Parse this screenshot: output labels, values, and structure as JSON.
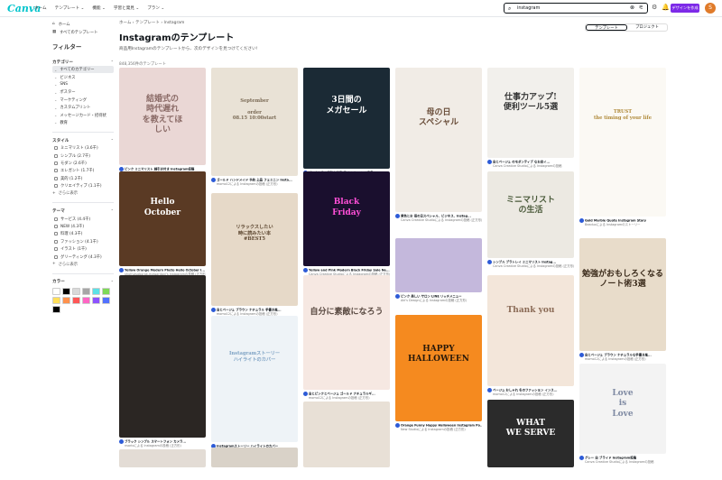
{
  "topbar": {
    "logo": "Canva",
    "nav": [
      "ホーム",
      "テンプレート ⌄",
      "機能 ⌄",
      "学習と発見 ⌄",
      "プラン ⌄"
    ],
    "search_value": "instagram",
    "create_button": "デザインを作成",
    "avatar_initial": "S"
  },
  "sidebar": {
    "home": "ホーム",
    "all_templates": "すべてのテンプレート",
    "filter_title": "フィルター",
    "sections": [
      {
        "title": "カテゴリー",
        "items": [
          "すべてのカテゴリー",
          "ビジネス",
          "SNS",
          "ポスター",
          "マーケティング",
          "カスタムプリント",
          "メッセージカード・招待状",
          "教育"
        ],
        "selected": 0,
        "type": "chevron"
      },
      {
        "title": "スタイル",
        "items": [
          "ミニマリスト (3.6千)",
          "シンプル (2.7千)",
          "モダン (2.6千)",
          "エレガント (1.7千)",
          "美的 (1.2千)",
          "クリエイティブ (1.1千)"
        ],
        "more": "さらに表示",
        "type": "check"
      },
      {
        "title": "テーマ",
        "items": [
          "サービス (4.4千)",
          "NEW (4.3千)",
          "料理 (4.3千)",
          "ファッション (4.1千)",
          "イラスト (1千)",
          "グリーティング (4.3千)"
        ],
        "more": "さらに表示",
        "type": "check"
      }
    ],
    "color_title": "カラー",
    "colors": [
      "#ffffff",
      "#000000",
      "#d9d9d9",
      "#a6a6a6",
      "#5ce1e6",
      "#7ed957",
      "#ffde59",
      "#ff914d",
      "#ff5757",
      "#ff66c4",
      "#8c52ff",
      "#5271ff",
      "#000000"
    ]
  },
  "main": {
    "breadcrumb": "ホーム  ›  テンプレート  ›  Instagram",
    "title": "Instagramのテンプレート",
    "subtitle": "商品用Instagramのテンプレートから、次のデザインを見つけてください!",
    "count": "848,356件のテンプレート",
    "tabs": [
      "テンプレート",
      "プロジェクト"
    ]
  },
  "cards": [
    {
      "title": "ピンク ミニマリスト 線引き付き Instagram投稿",
      "author": "Canva Creative Studioによる Instagramの投稿 (正方形)",
      "bg": "#ead7d5",
      "text": "結婚式の\n時代遅れ\nを教えてほ\nしい",
      "fg": "#8a6a66"
    },
    {
      "title": "Yellow Orange Modern Photo Hello October I...",
      "author": "shuhyasoborak-mawardani's Instagramの投稿 (正方形)",
      "bg": "#5a3a24",
      "text": "Hello\nOctober",
      "fg": "#ffffff"
    },
    {
      "title": "ブラック シンプル スマートフォン カメラ...",
      "author": "nsarioによる Instagramの投稿 (正方形)",
      "bg": "#2b2623",
      "text": "",
      "fg": "#fff"
    },
    {
      "title": "",
      "author": "",
      "bg": "#e3dcd5",
      "text": "",
      "fg": "#fff"
    },
    {
      "title": "ゴールド ハンドメイド 予約 上品 フェミニン Insta...",
      "author": "momo12による Instagramの投稿 (正方形)",
      "bg": "#e9e2d6",
      "text": "September\n\norder\n08.15 10:00start",
      "fg": "#7a6a55"
    },
    {
      "title": "白とベージュ ブラウン ナチュラル 手書き風...",
      "author": "momo12による Instagramの投稿 (正方形)",
      "bg": "#e6d9c8",
      "text": "リラックスしたい\n時に読みたい本\n#BEST5",
      "fg": "#5c4630"
    },
    {
      "title": "Instagramストーリー ハイライトのカバー",
      "author": "",
      "bg": "#eef3f7",
      "text": "Instagramストーリー\nハイライトのカバー",
      "fg": "#7fa3c5"
    },
    {
      "title": "",
      "author": "",
      "bg": "#d9d2c8",
      "text": "",
      "fg": "#fff"
    },
    {
      "title": "ピンクと白の素敵な写真 ラベル セール の商品...",
      "author": "Canva Creative Studioによる Instagramの投稿 (正方形)",
      "bg": "#1b2a35",
      "text": "3日間の\nメガセール",
      "fg": "#ffffff"
    },
    {
      "title": "Yellow and Pink Modern Black Friday Sale Ne...",
      "author": "Canva Creative Studioによる Instagramの投稿 (正方形)",
      "bg": "#1a0f2e",
      "text": "Black\nFriday",
      "fg": "#ff4fd8"
    },
    {
      "title": "白とピンクとベージュ ゴールド ナチュラルギ...",
      "author": "momo12による Instagramの投稿 (正方形)",
      "bg": "#f6e8e2",
      "text": "自分に素敵になろう",
      "fg": "#5a4a42"
    },
    {
      "title": "",
      "author": "",
      "bg": "#e8e0d6",
      "text": "",
      "fg": "#fff"
    },
    {
      "title": "黄色とお 母の日スペシャル、ビジネス、Instag...",
      "author": "Canva Creative Studioによる Instagramの投稿 (正方形)",
      "bg": "#f1ece6",
      "text": "母の日\nスペシャル",
      "fg": "#6a4e3a"
    },
    {
      "title": "ピンク 美しい サロン LINE リッチメニュー",
      "author": "Aki's Designによる Instagramの投稿 (正方形)",
      "bg": "#c4b8dc",
      "text": "",
      "fg": "#fff"
    },
    {
      "title": "Orange Funny Happy Halloween Instagram Po...",
      "author": "New Studioによる Instagramの投稿 (正方形)",
      "bg": "#f58a1f",
      "text": "HAPPY HALLOWEEN",
      "fg": "#2a1a0a"
    },
    {
      "title": "白とベージュ のモダンティブ なお店イ...",
      "author": "Canva Creative Studioによる Instagramの投稿",
      "bg": "#f2f0ec",
      "text": "仕事力アップ!\n便利ツール5選",
      "fg": "#333"
    },
    {
      "title": "シンプル ブラトレイ ミニマリスト Instag...",
      "author": "Canva Creative Studioによる Instagramの投稿 (正方形)",
      "bg": "#ece9e2",
      "text": "ミニマリスト\nの生活",
      "fg": "#4a5a3a"
    },
    {
      "title": "ベージュ おしゃれ 冬のファッション インス...",
      "author": "momo12による Instagramの投稿 (正方形)",
      "bg": "#f3e6da",
      "text": "Thank you",
      "fg": "#8a6a55"
    },
    {
      "title": "",
      "author": "",
      "bg": "#2b2b2b",
      "text": "WHAT\nWE SERVE",
      "fg": "#fff"
    },
    {
      "title": "Gold Marble Quote Instagram Story",
      "author": "Beaduxによる Instagramのストーリー",
      "bg": "#fbf9f4",
      "text": "TRUST\nthe timing of your life",
      "fg": "#b08a3a"
    },
    {
      "title": "白とベージュ ブラウン ナチュラルな手書き風...",
      "author": "momo12による Instagramの投稿 (正方形)",
      "bg": "#e8dcca",
      "text": "勉強がおもしろくなる\nノート術3選",
      "fg": "#3a2a1a"
    },
    {
      "title": "グレー 白 ブライド Instagram投稿",
      "author": "Canva Creative Studioによる Instagramの投稿",
      "bg": "#f3f3f3",
      "text": "Love\nis\nLove",
      "fg": "#7f8aa3"
    }
  ]
}
